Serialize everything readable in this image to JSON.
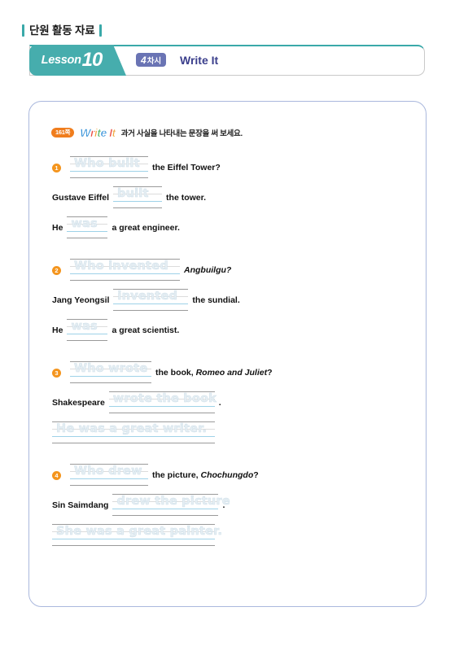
{
  "top_label": {
    "text": "단원 활동 자료"
  },
  "header": {
    "lesson_word": "Lesson",
    "lesson_number": "10",
    "period_number": "4",
    "period_unit": "차시",
    "title": "Write It"
  },
  "instruction": {
    "page_badge": "161쪽",
    "logo_letters": [
      "W",
      "r",
      "i",
      "t",
      "e",
      "I",
      "t"
    ],
    "text": "과거 사실을 나타내는 문장을 써 보세요."
  },
  "questions": [
    {
      "number": "1",
      "lines": [
        {
          "layout": "trace-then-text",
          "trace": "Who built",
          "trace_width": 96,
          "after": "the Eiffel Tower?"
        },
        {
          "layout": "text-trace-text",
          "before": "Gustave Eiffel",
          "trace": "built",
          "trace_width": 60,
          "after": "the tower."
        },
        {
          "layout": "text-trace-text",
          "before": "He",
          "trace": "was",
          "trace_width": 50,
          "after": "a great engineer."
        }
      ]
    },
    {
      "number": "2",
      "lines": [
        {
          "layout": "trace-then-text",
          "trace": "Who invented",
          "trace_width": 135,
          "after": "Angbuilgu?",
          "after_italic": true
        },
        {
          "layout": "text-trace-text",
          "before": "Jang Yeongsil",
          "trace": "invented",
          "trace_width": 92,
          "after": "the sundial."
        },
        {
          "layout": "text-trace-text",
          "before": "He",
          "trace": "was",
          "trace_width": 50,
          "after": "a great scientist."
        }
      ]
    },
    {
      "number": "3",
      "lines": [
        {
          "layout": "trace-then-text",
          "trace": "Who wrote",
          "trace_width": 100,
          "after": "the book, ",
          "after_em": "Romeo and Juliet",
          "after_tail": "?"
        },
        {
          "layout": "text-trace-text",
          "before": "Shakespeare",
          "trace": "wrote the book",
          "trace_width": 130,
          "after": "."
        },
        {
          "layout": "full-trace",
          "trace": "He was a great writer.",
          "trace_width": 200
        }
      ]
    },
    {
      "number": "4",
      "lines": [
        {
          "layout": "trace-then-text",
          "trace": "Who drew",
          "trace_width": 96,
          "after": "the picture, ",
          "after_em": "Chochungdo",
          "after_tail": "?"
        },
        {
          "layout": "text-trace-text",
          "before": "Sin Saimdang",
          "trace": "drew the picture",
          "trace_width": 130,
          "after": "."
        },
        {
          "layout": "full-trace",
          "trace": "She was a great painter.",
          "trace_width": 200
        }
      ]
    }
  ],
  "colors": {
    "teal": "#46adad",
    "purple": "#6a74b4",
    "title_navy": "#3b3f8c",
    "orange": "#f07d1d",
    "qnum_orange": "#f4951e",
    "card_border": "#aab8dd",
    "baseline_blue": "#9ed2e8",
    "trace_text": "#cfe0ea"
  }
}
